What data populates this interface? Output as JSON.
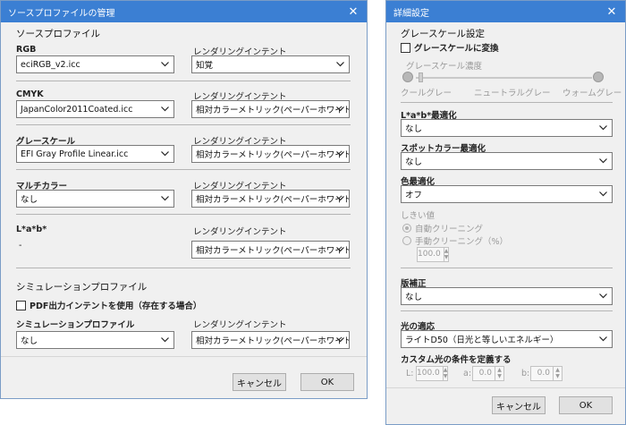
{
  "left_dialog": {
    "title": "ソースプロファイルの管理",
    "section_title": "ソースプロファイル",
    "rows": [
      {
        "label": "RGB",
        "value": "eciRGB_v2.icc",
        "intent_label": "レンダリングインテント",
        "intent": "知覚"
      },
      {
        "label": "CMYK",
        "value": "JapanColor2011Coated.icc",
        "intent_label": "レンダリングインテント",
        "intent": "相対カラーメトリック(ペーパーホワイトなし)"
      },
      {
        "label": "グレースケール",
        "value": "EFI Gray Profile Linear.icc",
        "intent_label": "レンダリングインテント",
        "intent": "相対カラーメトリック(ペーパーホワイトなし)"
      },
      {
        "label": "マルチカラー",
        "value": "なし",
        "intent_label": "レンダリングインテント",
        "intent": "相対カラーメトリック(ペーパーホワイトなし)"
      }
    ],
    "lab": {
      "label": "L*a*b*",
      "value": "-",
      "intent_label": "レンダリングインテント",
      "intent": "相対カラーメトリック(ペーパーホワイトなし)"
    },
    "simulation": {
      "section_title": "シミュレーションプロファイル",
      "checkbox_label": "PDF出力インテントを使用（存在する場合）",
      "profile_label": "シミュレーションプロファイル",
      "profile_value": "なし",
      "intent_label": "レンダリングインテント",
      "intent": "相対カラーメトリック(ペーパーホワイトなし)"
    },
    "cancel_label": "キャンセル",
    "ok_label": "OK"
  },
  "right_dialog": {
    "title": "詳細設定",
    "gray_section": "グレースケール設定",
    "gray_convert_label": "グレースケールに変換",
    "gray_density_label": "グレースケール濃度",
    "slider_labels": {
      "left": "クールグレー",
      "mid": "ニュートラルグレー",
      "right": "ウォームグレー"
    },
    "lab_opt_label": "L*a*b*最適化",
    "lab_opt_value": "なし",
    "spot_opt_label": "スポットカラー最適化",
    "spot_opt_value": "なし",
    "color_opt_label": "色最適化",
    "color_opt_value": "オフ",
    "threshold_label": "しきい値",
    "auto_clean_label": "自動クリーニング",
    "manual_clean_label": "手動クリーニング（%）",
    "manual_clean_value": "100.0",
    "plate_label": "版補正",
    "plate_value": "なし",
    "light_label": "光の適応",
    "light_value": "ライトD50（日光と等しいエネルギー）",
    "custom_light_label": "カスタム光の条件を定義する",
    "L_label": "L:",
    "L_value": "100.0",
    "a_label": "a:",
    "a_value": "0.0",
    "b_label": "b:",
    "b_value": "0.0",
    "cancel_label": "キャンセル",
    "ok_label": "OK"
  },
  "colors": {
    "titlebar": "#3b7fd3",
    "dialog_bg": "#f0f0f0"
  }
}
